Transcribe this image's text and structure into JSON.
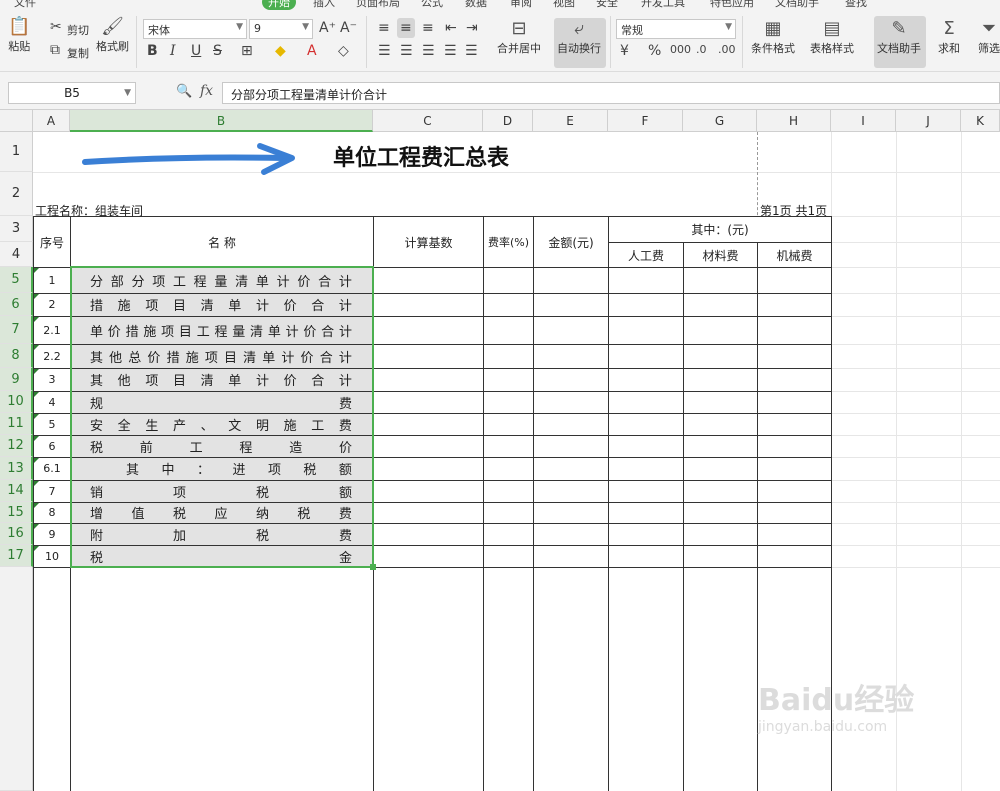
{
  "menu": {
    "file": "文件",
    "home": "开始",
    "insert": "插入",
    "page_layout": "页面布局",
    "formula": "公式",
    "data": "数据",
    "review": "审阅",
    "view": "视图",
    "security": "安全",
    "developer": "开发工具",
    "special": "特色应用",
    "doc_assistant": "文档助手",
    "search": "查找"
  },
  "ribbon": {
    "paste": "粘贴",
    "cut": "剪切",
    "copy": "复制",
    "format_painter": "格式刷",
    "font_name": "宋体",
    "font_size": "9",
    "bold": "B",
    "italic": "I",
    "underline": "U",
    "strike": "S",
    "merge_center": "合并居中",
    "auto_wrap": "自动换行",
    "number_format": "常规",
    "cond_format": "条件格式",
    "table_style": "表格样式",
    "doc_helper": "文档助手",
    "sum": "求和",
    "filter": "筛选"
  },
  "formula_bar": {
    "name_box": "B5",
    "fx": "fx",
    "value": "分部分项工程量清单计价合计"
  },
  "columns": [
    "A",
    "B",
    "C",
    "D",
    "E",
    "F",
    "G",
    "H",
    "I",
    "J",
    "K"
  ],
  "rows": [
    "1",
    "2",
    "3",
    "4",
    "5",
    "6",
    "7",
    "8",
    "9",
    "10",
    "11",
    "12",
    "13",
    "14",
    "15",
    "16",
    "17"
  ],
  "sheet": {
    "title": "单位工程费汇总表",
    "project_name": "工程名称：组装车间",
    "page_info": "第1页 共1页",
    "headers": {
      "seq": "序号",
      "name": "名    称",
      "calc_base": "计算基数",
      "rate": "费率(%)",
      "amount": "金额(元)",
      "of_which": "其中：(元)",
      "labor": "人工费",
      "material": "材料费",
      "machine": "机械费"
    },
    "items": [
      {
        "seq": "1",
        "name": "分部分项工程量清单计价合计"
      },
      {
        "seq": "2",
        "name": "措施项目清单计价合计"
      },
      {
        "seq": "2.1",
        "name": "单价措施项目工程量清单计价合计"
      },
      {
        "seq": "2.2",
        "name": "其他总价措施项目清单计价合计"
      },
      {
        "seq": "3",
        "name": "其他项目清单计价合计"
      },
      {
        "seq": "4",
        "name": "规费"
      },
      {
        "seq": "5",
        "name": "安全生产、文明施工费"
      },
      {
        "seq": "6",
        "name": "税前工程造价"
      },
      {
        "seq": "6.1",
        "name": "其中：进项税额"
      },
      {
        "seq": "7",
        "name": "销项税额"
      },
      {
        "seq": "8",
        "name": "增值税应纳税费"
      },
      {
        "seq": "9",
        "name": "附加税费"
      },
      {
        "seq": "10",
        "name": "税金"
      }
    ]
  },
  "watermark": {
    "brand": "Baidu经验",
    "url": "jingyan.baidu.com"
  },
  "colors": {
    "accent": "#4caf50",
    "arrow": "#3a7fd5",
    "selection_fill": "#e3e3e3"
  }
}
